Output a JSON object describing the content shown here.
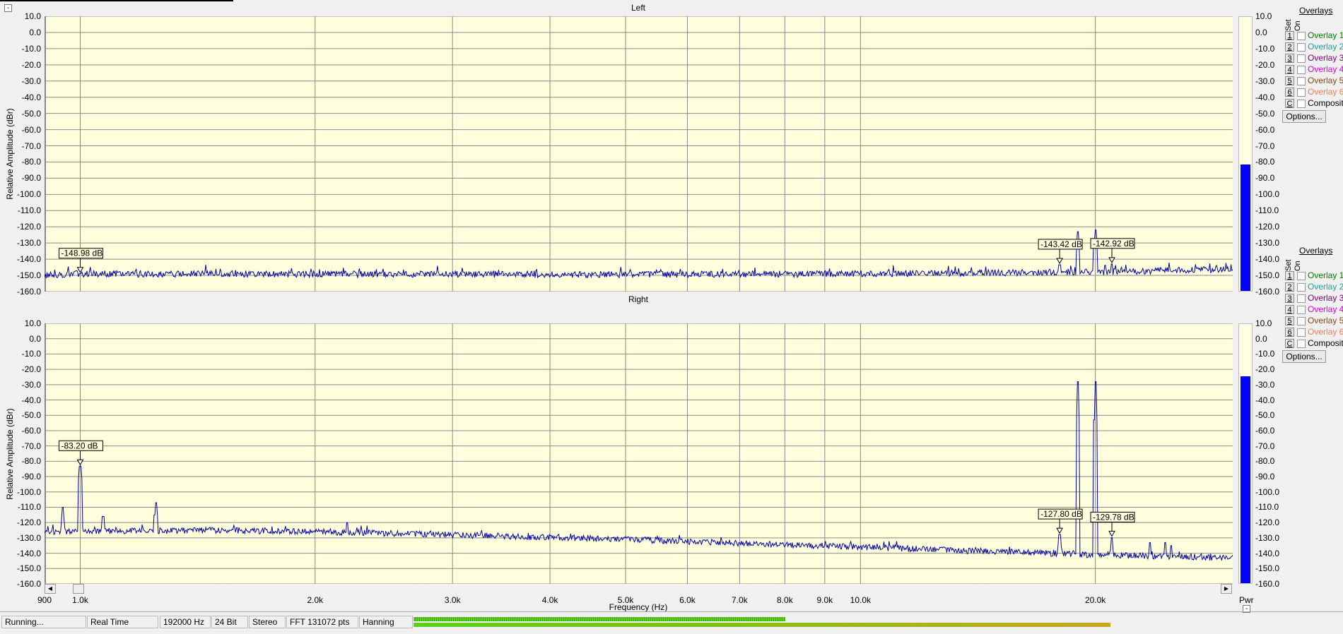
{
  "window": {
    "collapse_label": "-"
  },
  "panels": [
    {
      "title": "Left",
      "ylabel": "Relative Amplitude (dBr)",
      "meter_level_db": -82
    },
    {
      "title": "Right",
      "ylabel": "Relative Amplitude (dBr)",
      "meter_level_db": -25
    }
  ],
  "y_ticks": [
    "10.0",
    "0.0",
    "-10.0",
    "-20.0",
    "-30.0",
    "-40.0",
    "-50.0",
    "-60.0",
    "-70.0",
    "-80.0",
    "-90.0",
    "-100.0",
    "-110.0",
    "-120.0",
    "-130.0",
    "-140.0",
    "-150.0",
    "-160.0"
  ],
  "x_axis": {
    "label": "Frequency (Hz)",
    "ticks": [
      {
        "value": 900,
        "label": "900"
      },
      {
        "value": 1000,
        "label": "1.0k"
      },
      {
        "value": 2000,
        "label": "2.0k"
      },
      {
        "value": 3000,
        "label": "3.0k"
      },
      {
        "value": 4000,
        "label": "4.0k"
      },
      {
        "value": 5000,
        "label": "5.0k"
      },
      {
        "value": 6000,
        "label": "6.0k"
      },
      {
        "value": 7000,
        "label": "7.0k"
      },
      {
        "value": 8000,
        "label": "8.0k"
      },
      {
        "value": 9000,
        "label": "9.0k"
      },
      {
        "value": 10000,
        "label": "10.0k"
      },
      {
        "value": 20000,
        "label": "20.0k"
      }
    ]
  },
  "meter": {
    "label": "Pwr",
    "collapse_label": "-",
    "color": "#0000ff"
  },
  "overlays": {
    "title": "Overlays",
    "set_label": "Set",
    "on_label": "On",
    "items": [
      {
        "key": "1",
        "label": "Overlay 1",
        "color": "#008000",
        "checked": false
      },
      {
        "key": "2",
        "label": "Overlay 2",
        "color": "#20a0a0",
        "checked": false
      },
      {
        "key": "3",
        "label": "Overlay 3",
        "color": "#800080",
        "checked": false
      },
      {
        "key": "4",
        "label": "Overlay 4",
        "color": "#e000e0",
        "checked": false
      },
      {
        "key": "5",
        "label": "Overlay 5",
        "color": "#8b4513",
        "checked": false
      },
      {
        "key": "6",
        "label": "Overlay 6",
        "color": "#f08050",
        "checked": false
      },
      {
        "key": "C",
        "label": "Composite",
        "color": "#000000",
        "checked": false
      }
    ],
    "options_label": "Options..."
  },
  "status": {
    "state": "Running...",
    "mode": "Real Time",
    "sample_rate": "192000 Hz",
    "bit_depth": "24 Bit",
    "channels": "Stereo",
    "fft": "FFT 131072 pts",
    "window": "Hanning",
    "input_level_top": 0.47,
    "input_level_bottom": 0.88
  },
  "chart_data": [
    {
      "type": "line",
      "title": "Left",
      "xlabel": "Frequency (Hz)",
      "ylabel": "Relative Amplitude (dBr)",
      "x_scale": "log",
      "xlim": [
        900,
        30000
      ],
      "ylim": [
        -160,
        10
      ],
      "grid": true,
      "trace_color": "#0000aa",
      "noise_floor": [
        [
          900,
          -150
        ],
        [
          1000,
          -149
        ],
        [
          5000,
          -149.5
        ],
        [
          10000,
          -149
        ],
        [
          20000,
          -148
        ],
        [
          30000,
          -146
        ]
      ],
      "peaks": [
        [
          1000,
          -148.98
        ],
        [
          18000,
          -143.42
        ],
        [
          19000,
          -123
        ],
        [
          20000,
          -122
        ],
        [
          21000,
          -142.92
        ]
      ],
      "markers": [
        {
          "freq": 1000,
          "label": "-148.98 dB"
        },
        {
          "freq": 18000,
          "label": "-143.42 dB"
        },
        {
          "freq": 21000,
          "label": "-142.92 dB"
        }
      ]
    },
    {
      "type": "line",
      "title": "Right",
      "xlabel": "Frequency (Hz)",
      "ylabel": "Relative Amplitude (dBr)",
      "x_scale": "log",
      "xlim": [
        900,
        30000
      ],
      "ylim": [
        -160,
        10
      ],
      "grid": true,
      "trace_color": "#0000aa",
      "noise_floor": [
        [
          900,
          -126
        ],
        [
          1500,
          -125
        ],
        [
          2000,
          -126
        ],
        [
          3000,
          -128
        ],
        [
          5000,
          -131
        ],
        [
          10000,
          -136
        ],
        [
          20000,
          -141
        ],
        [
          30000,
          -143
        ]
      ],
      "peaks": [
        [
          950,
          -110
        ],
        [
          1000,
          -83.2
        ],
        [
          1070,
          -116
        ],
        [
          1250,
          -107
        ],
        [
          2200,
          -120
        ],
        [
          18000,
          -127.8
        ],
        [
          19000,
          -28
        ],
        [
          20000,
          -28
        ],
        [
          21000,
          -129.78
        ],
        [
          23500,
          -133
        ],
        [
          24600,
          -133
        ],
        [
          25000,
          -135
        ]
      ],
      "markers": [
        {
          "freq": 1000,
          "label": "-83.20 dB"
        },
        {
          "freq": 18000,
          "label": "-127.80 dB"
        },
        {
          "freq": 21000,
          "label": "-129.78 dB"
        }
      ]
    }
  ]
}
